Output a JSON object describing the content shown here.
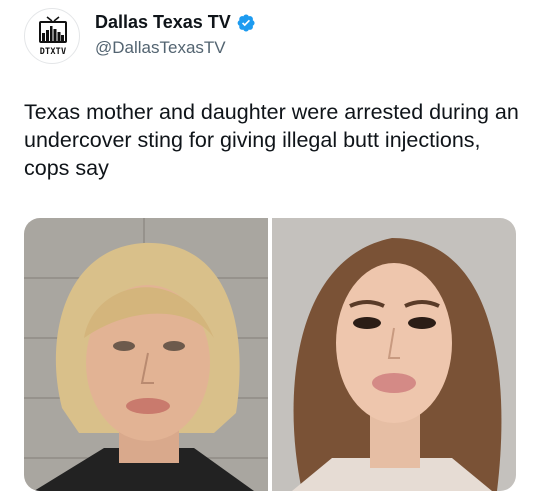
{
  "account": {
    "display_name": "Dallas Texas TV",
    "handle": "@DallasTexasTV",
    "verified": true,
    "verified_color": "#1d9bf0",
    "avatar_logo_text": "DTXTV"
  },
  "tweet": {
    "text": "Texas mother and daughter were arrested during an undercover sting for giving illegal butt injections, cops say"
  },
  "media": {
    "count": 2,
    "photos": [
      {
        "description_icon": "mugshot-photo-left"
      },
      {
        "description_icon": "mugshot-photo-right"
      }
    ]
  },
  "colors": {
    "text": "#0f1419",
    "secondary": "#536471"
  }
}
